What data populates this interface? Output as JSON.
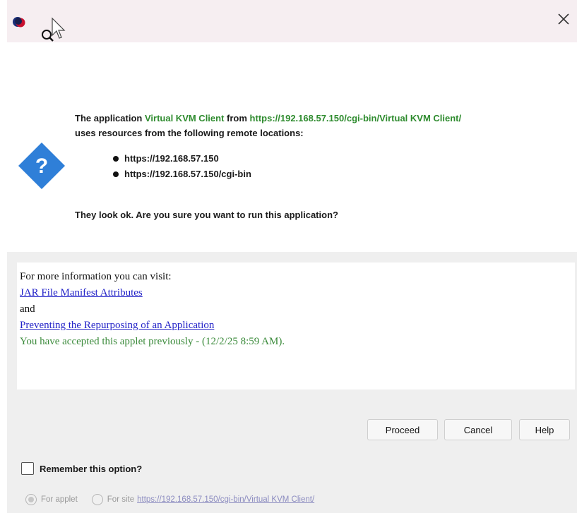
{
  "dialog": {
    "message_parts": [
      "The application ",
      "Virtual KVM Client",
      " from ",
      "https://192.168.57.150/cgi-bin/Virtual KVM Client/"
    ],
    "message_line2": "uses resources from the following remote locations:",
    "locations": [
      "https://192.168.57.150",
      "https://192.168.57.150/cgi-bin"
    ],
    "question": "They look ok. Are you sure you want to run this application?"
  },
  "info": {
    "intro": "For more information you can visit:",
    "link1": "JAR File Manifest Attributes",
    "and": "and",
    "link2": "Preventing the Repurposing of an Application",
    "accepted": "You have accepted this applet previously - (12/2/25 8:59 AM)."
  },
  "buttons": {
    "proceed": "Proceed",
    "cancel": "Cancel",
    "help": "Help"
  },
  "remember": {
    "label": "Remember this option?",
    "checked": false,
    "for_applet": "For applet",
    "for_site": "For site",
    "site_url": "https://192.168.57.150/cgi-bin/Virtual KVM Client/"
  },
  "colors": {
    "green": "#2e8b2e",
    "link": "#2323c8",
    "icon_blue": "#2f7fd8"
  }
}
